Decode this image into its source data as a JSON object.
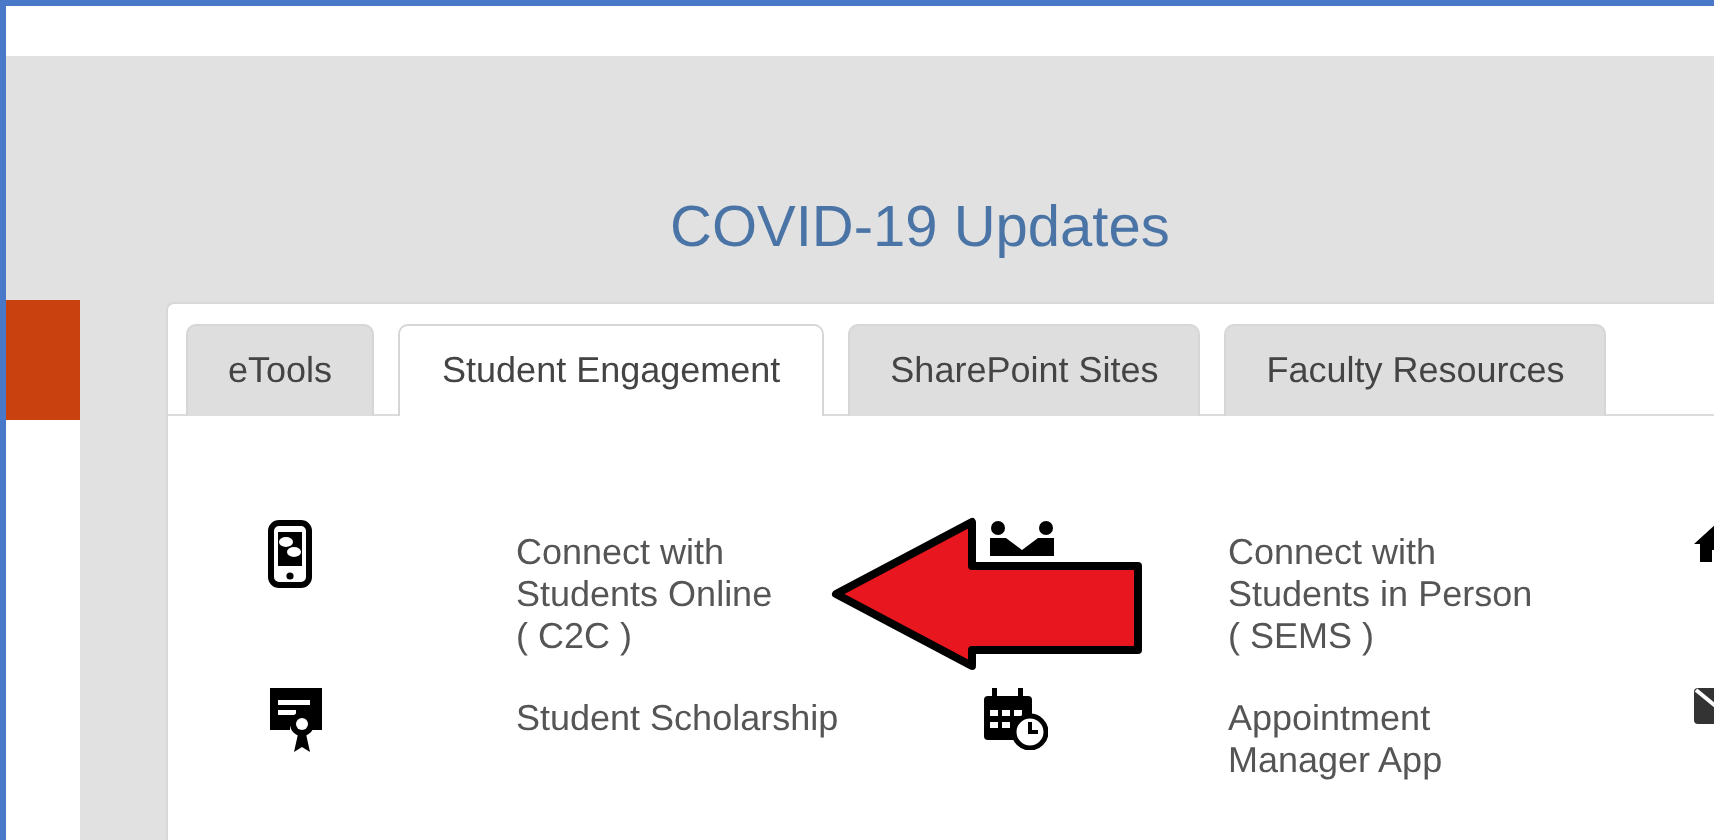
{
  "title": "COVID-19 Updates",
  "tabs": [
    {
      "label": "eTools",
      "selected": false
    },
    {
      "label": "Student Engagement",
      "selected": true
    },
    {
      "label": "SharePoint Sites",
      "selected": false
    },
    {
      "label": "Faculty Resources",
      "selected": false
    }
  ],
  "rows": [
    {
      "links": [
        {
          "label": "Connect with\nStudents Online\n( C2C )"
        },
        {
          "label": "Connect with\nStudents in Person\n( SEMS )"
        }
      ]
    },
    {
      "links": [
        {
          "label": "Student Scholarship"
        },
        {
          "label": "Appointment\nManager App"
        }
      ]
    }
  ]
}
